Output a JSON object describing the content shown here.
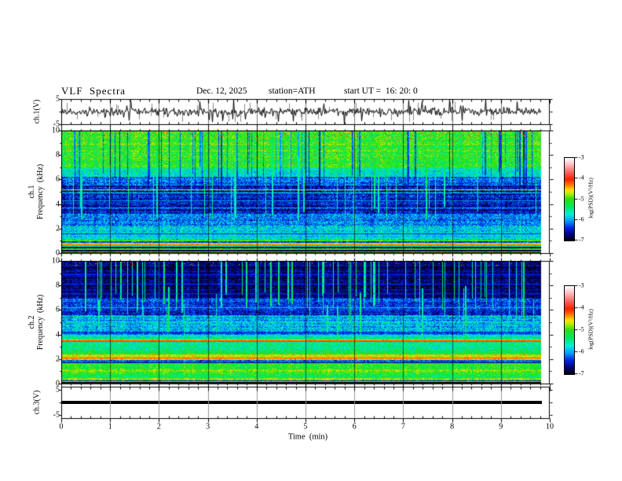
{
  "figure": {
    "header": {
      "title": "VLF  Spectra",
      "date": "Dec. 12, 2025",
      "station": "station=ATH",
      "start_ut": "start UT =  16: 20: 0"
    },
    "time_axis": {
      "label": "Time  (min)",
      "ticks": [
        0,
        1,
        2,
        3,
        4,
        5,
        6,
        7,
        8,
        9,
        10
      ],
      "minor_step": 0.2,
      "range": [
        0,
        10
      ],
      "data_end": 9.83
    }
  },
  "panels": {
    "waveform": {
      "ylabel": "ch.1(V)",
      "yticks": [
        5,
        -5
      ],
      "ylim": [
        -5,
        5
      ]
    },
    "spec1": {
      "ylabel_line1": "ch.1",
      "ylabel_line2": "Frequency  (kHz)",
      "yticks": [
        10,
        8,
        6,
        4,
        2,
        0
      ],
      "ylim": [
        0,
        10
      ]
    },
    "spec2": {
      "ylabel_line1": "ch.2",
      "ylabel_line2": "Frequency  (kHz)",
      "yticks": [
        10,
        8,
        6,
        4,
        2,
        0
      ],
      "ylim": [
        0,
        10
      ]
    },
    "ch3": {
      "ylabel": "ch.3(V)",
      "yticks": [
        5,
        -5
      ],
      "ylim": [
        -5,
        5
      ]
    }
  },
  "colorbar": {
    "label": "log(PSD)(V²/Hz)",
    "ticks": [
      -3,
      -4,
      -5,
      -6,
      -7
    ],
    "range": [
      -7,
      -3
    ],
    "stops": [
      [
        -7,
        "#000000"
      ],
      [
        -6.72,
        "#000075"
      ],
      [
        -6.38,
        "#0022e8"
      ],
      [
        -6.05,
        "#009cff"
      ],
      [
        -5.72,
        "#00f0d8"
      ],
      [
        -5.38,
        "#00e868"
      ],
      [
        -5.0,
        "#2ade12"
      ],
      [
        -4.72,
        "#b8ef00"
      ],
      [
        -4.55,
        "#ffe000"
      ],
      [
        -4.35,
        "#ff8a00"
      ],
      [
        -4.05,
        "#ff1c00"
      ],
      [
        -3.7,
        "#ff5f5f"
      ],
      [
        -3.3,
        "#ffc2c6"
      ],
      [
        -3.0,
        "#ffffff"
      ]
    ]
  },
  "chart_data": [
    {
      "type": "line",
      "name": "ch1-waveform",
      "ylabel": "ch.1(V)",
      "xlim": [
        0,
        10
      ],
      "ylim": [
        -5,
        5
      ],
      "signal": {
        "mean": 0,
        "noise_std": 0.8,
        "spike_prob": 0.07,
        "spike_min": 1.5,
        "spike_max": 4.2,
        "seed": 911
      }
    },
    {
      "type": "heatmap",
      "name": "ch1-spectrogram",
      "ylabel": "ch.1 Frequency (kHz)",
      "xlim": [
        0,
        10
      ],
      "ylim": [
        0,
        10
      ],
      "zlim": [
        -7,
        -3
      ],
      "seed": 1337,
      "bands": [
        [
          0.0,
          0.08,
          -7.0,
          0.15
        ],
        [
          0.08,
          0.16,
          -5.0,
          0.3
        ],
        [
          0.16,
          0.26,
          -6.9,
          0.25
        ],
        [
          0.26,
          0.36,
          -5.1,
          0.3
        ],
        [
          0.36,
          0.52,
          -6.7,
          0.3
        ],
        [
          0.52,
          0.62,
          -5.6,
          0.3
        ],
        [
          0.62,
          0.85,
          -4.65,
          0.3
        ],
        [
          0.85,
          0.97,
          -6.2,
          0.3
        ],
        [
          0.97,
          1.12,
          -4.95,
          0.3
        ],
        [
          1.12,
          2.2,
          -5.8,
          0.4
        ],
        [
          2.2,
          3.2,
          -6.1,
          0.4
        ],
        [
          3.2,
          5.5,
          -6.5,
          0.4
        ],
        [
          5.5,
          6.2,
          -6.15,
          0.4
        ],
        [
          6.2,
          7.0,
          -5.6,
          0.4
        ],
        [
          7.0,
          10.0,
          -5.05,
          0.35
        ]
      ],
      "hlines": [
        {
          "f": 5.2,
          "level": -4.3,
          "w": 1
        },
        {
          "f": 4.95,
          "level": -5.6,
          "w": 1
        },
        {
          "f": 4.3,
          "level": -5.9,
          "w": 1
        },
        {
          "f": 3.75,
          "level": -5.95,
          "w": 1
        },
        {
          "f": 0.73,
          "level": -4.2,
          "w": 1
        },
        {
          "f": 1.6,
          "level": -6.5,
          "w": 1
        }
      ],
      "streaks": [
        {
          "prob": 0.12,
          "level": -6.55,
          "jitter": 0.3,
          "fmin_lo": 4.5,
          "fmin_hi": 7.5,
          "fmax_lo": 10,
          "fmax_hi": 10
        },
        {
          "prob": 0.05,
          "level": -5.25,
          "jitter": 0.25,
          "fmin_lo": 2.6,
          "fmin_hi": 4.0,
          "fmax_lo": 6.0,
          "fmax_hi": 9.5
        }
      ],
      "speckles": [
        {
          "fmin": 9.5,
          "fmax": 10,
          "prob": 0.05,
          "level": -3.9,
          "jitter": 0.4
        },
        {
          "fmin": 7.2,
          "fmax": 9.5,
          "prob": 0.005,
          "level": -4.2,
          "jitter": 0.3
        }
      ]
    },
    {
      "type": "heatmap",
      "name": "ch2-spectrogram",
      "ylabel": "ch.2 Frequency (kHz)",
      "xlim": [
        0,
        10
      ],
      "ylim": [
        0,
        10
      ],
      "zlim": [
        -7,
        -3
      ],
      "seed": 2718,
      "bands": [
        [
          0.0,
          0.1,
          -7.0,
          0.15
        ],
        [
          0.1,
          0.18,
          -4.8,
          0.25
        ],
        [
          0.18,
          0.28,
          -6.6,
          0.25
        ],
        [
          0.28,
          0.42,
          -4.9,
          0.3
        ],
        [
          0.42,
          0.62,
          -5.3,
          0.3
        ],
        [
          0.62,
          0.95,
          -5.1,
          0.3
        ],
        [
          0.95,
          1.15,
          -4.8,
          0.3
        ],
        [
          1.15,
          1.65,
          -5.15,
          0.3
        ],
        [
          1.65,
          1.9,
          -6.2,
          0.3
        ],
        [
          1.9,
          2.4,
          -4.6,
          0.3
        ],
        [
          2.4,
          2.8,
          -5.3,
          0.3
        ],
        [
          2.8,
          3.4,
          -5.5,
          0.35
        ],
        [
          3.4,
          3.62,
          -4.7,
          0.3
        ],
        [
          3.62,
          4.0,
          -5.6,
          0.35
        ],
        [
          4.0,
          4.4,
          -6.05,
          0.35
        ],
        [
          4.4,
          5.6,
          -5.9,
          0.4
        ],
        [
          5.6,
          7.0,
          -6.35,
          0.35
        ],
        [
          7.0,
          10.0,
          -6.75,
          0.3
        ]
      ],
      "hlines": [
        {
          "f": 3.5,
          "level": -4.05,
          "w": 2
        },
        {
          "f": 2.1,
          "level": -4.05,
          "w": 1
        },
        {
          "f": 1.75,
          "level": -6.85,
          "w": 1
        },
        {
          "f": 4.15,
          "level": -6.6,
          "w": 1
        },
        {
          "f": 5.05,
          "level": -5.5,
          "w": 1
        },
        {
          "f": 6.2,
          "level": -5.85,
          "w": 1
        },
        {
          "f": 7.4,
          "level": -6.25,
          "w": 1
        },
        {
          "f": 8.15,
          "level": -6.25,
          "w": 1
        },
        {
          "f": 8.9,
          "level": -6.3,
          "w": 1
        }
      ],
      "streaks": [
        {
          "prob": 0.11,
          "level": -5.15,
          "jitter": 0.3,
          "fmin_lo": 5.0,
          "fmin_hi": 7.5,
          "fmax_lo": 10,
          "fmax_hi": 10
        },
        {
          "prob": 0.03,
          "level": -5.3,
          "jitter": 0.2,
          "fmin_lo": 3.0,
          "fmin_hi": 4.5,
          "fmax_lo": 6.0,
          "fmax_hi": 8.0
        }
      ],
      "speckles": [
        {
          "fmin": 9.6,
          "fmax": 10,
          "prob": 0.02,
          "level": -4.2,
          "jitter": 0.3
        }
      ]
    },
    {
      "type": "line",
      "name": "ch3-flatline",
      "ylabel": "ch.3(V)",
      "xlim": [
        0,
        10
      ],
      "ylim": [
        -5,
        5
      ],
      "value": 0,
      "x_start": 0,
      "x_end": 9.83
    }
  ]
}
